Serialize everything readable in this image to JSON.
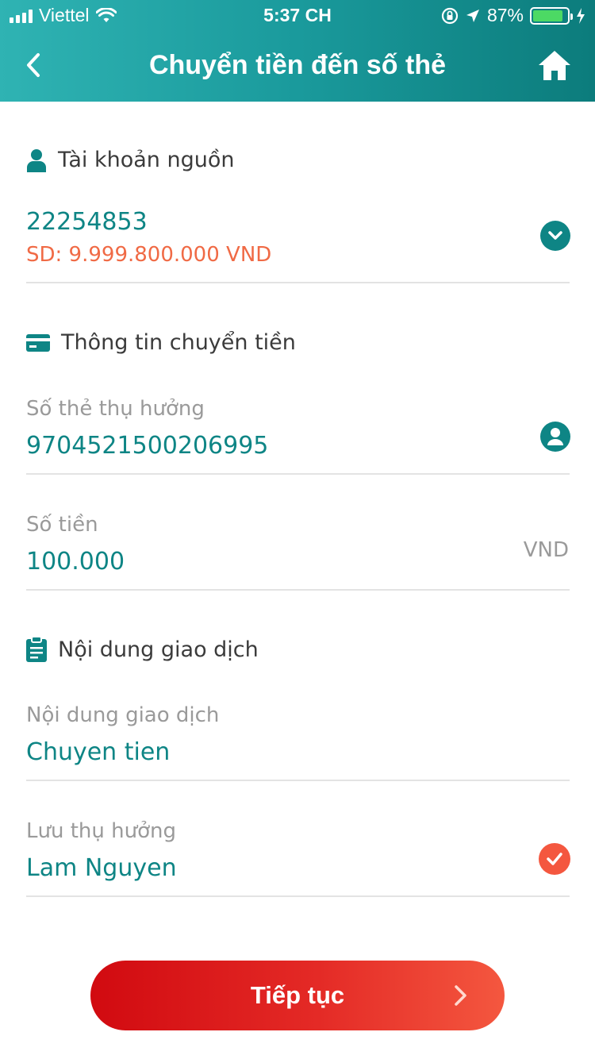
{
  "status_bar": {
    "carrier": "Viettel",
    "time": "5:37 CH",
    "battery_percent": "87%",
    "battery_level": 0.87
  },
  "nav": {
    "title": "Chuyển tiền đến số thẻ",
    "back_icon": "chevron-left-icon",
    "home_icon": "home-icon"
  },
  "source_account": {
    "section_label": "Tài khoản nguồn",
    "icon": "person-icon",
    "account_number": "22254853",
    "balance": "SD: 9.999.800.000  VND",
    "dropdown_icon": "chevron-down-icon"
  },
  "transfer_info": {
    "section_label": "Thông tin chuyển tiền",
    "icon": "card-icon",
    "card_number_label": "Số thẻ thụ hưởng",
    "card_number_value": "9704521500206995",
    "contact_icon": "contact-icon",
    "amount_label": "Số tiền",
    "amount_value": "100.000",
    "currency": "VND"
  },
  "transaction_content": {
    "section_label": "Nội dung giao dịch",
    "icon": "clipboard-icon",
    "content_label": "Nội dung giao dịch",
    "content_value": "Chuyen tien",
    "save_beneficiary_label": "Lưu thụ hưởng",
    "save_beneficiary_value": "Lam Nguyen",
    "save_checked": true
  },
  "actions": {
    "continue_label": "Tiếp tục"
  },
  "colors": {
    "teal": "#0e8585",
    "header_gradient_start": "#2fb3b3",
    "header_gradient_end": "#0c7c7c",
    "balance_orange": "#f06a45",
    "button_red": "#d10a10",
    "button_orange": "#f4573f"
  }
}
